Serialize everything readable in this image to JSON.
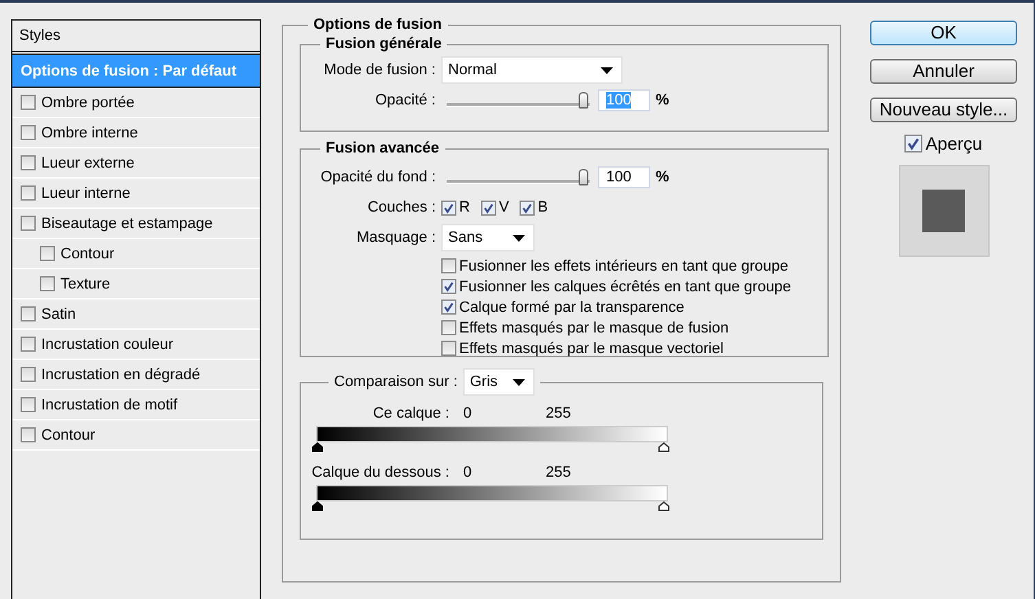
{
  "sidebar": {
    "header": "Styles",
    "items": [
      {
        "label": "Options de fusion : Par défaut",
        "kind": "heading",
        "selected": true
      },
      {
        "label": "Ombre portée",
        "kind": "check",
        "checked": false,
        "selected": false
      },
      {
        "label": "Ombre interne",
        "kind": "check",
        "checked": false,
        "selected": false
      },
      {
        "label": "Lueur externe",
        "kind": "check",
        "checked": false,
        "selected": false
      },
      {
        "label": "Lueur interne",
        "kind": "check",
        "checked": false,
        "selected": false
      },
      {
        "label": "Biseautage et estampage",
        "kind": "check",
        "checked": false,
        "selected": false,
        "children": [
          {
            "label": "Contour",
            "kind": "check",
            "checked": false,
            "selected": false
          },
          {
            "label": "Texture",
            "kind": "check",
            "checked": false,
            "selected": false
          }
        ]
      },
      {
        "label": "Satin",
        "kind": "check",
        "checked": false,
        "selected": false
      },
      {
        "label": "Incrustation couleur",
        "kind": "check",
        "checked": false,
        "selected": false
      },
      {
        "label": "Incrustation en dégradé",
        "kind": "check",
        "checked": false,
        "selected": false
      },
      {
        "label": "Incrustation de motif",
        "kind": "check",
        "checked": false,
        "selected": false
      },
      {
        "label": "Contour",
        "kind": "check",
        "checked": false,
        "selected": false
      }
    ]
  },
  "panel": {
    "title": "Options de fusion",
    "general": {
      "title": "Fusion générale",
      "mode_label": "Mode de fusion :",
      "mode_value": "Normal",
      "opacity_label": "Opacité :",
      "opacity": {
        "level": 1.0,
        "value": "100",
        "unit": "%"
      }
    },
    "advanced": {
      "title": "Fusion avancée",
      "fill_label": "Opacité du fond :",
      "fill": {
        "level": 1.0,
        "value": "100",
        "unit": "%"
      },
      "channels_label": "Couches :",
      "channels": [
        {
          "label": "R",
          "checked": true
        },
        {
          "label": "V",
          "checked": true
        },
        {
          "label": "B",
          "checked": true
        }
      ],
      "knockout_label": "Masquage :",
      "knockout_value": "Sans",
      "options": [
        {
          "label": "Fusionner les effets intérieurs en tant que groupe",
          "checked": false
        },
        {
          "label": "Fusionner les calques écrêtés en tant que groupe",
          "checked": true
        },
        {
          "label": "Calque formé par la transparence",
          "checked": true
        },
        {
          "label": "Effets masqués par le masque de fusion",
          "checked": false
        },
        {
          "label": "Effets masqués par le masque vectoriel",
          "checked": false
        }
      ]
    },
    "blend_if": {
      "label": "Comparaison sur :",
      "value": "Gris",
      "ranges": [
        {
          "label": "Ce calque :",
          "low": "0",
          "high": "255"
        },
        {
          "label": "Calque du dessous :",
          "low": "0",
          "high": "255"
        }
      ]
    }
  },
  "buttons": [
    {
      "label": "OK",
      "default": true
    },
    {
      "label": "Annuler",
      "default": false
    },
    {
      "label": "Nouveau style...",
      "default": false
    }
  ],
  "preview": {
    "label": "Aperçu",
    "checked": true
  }
}
